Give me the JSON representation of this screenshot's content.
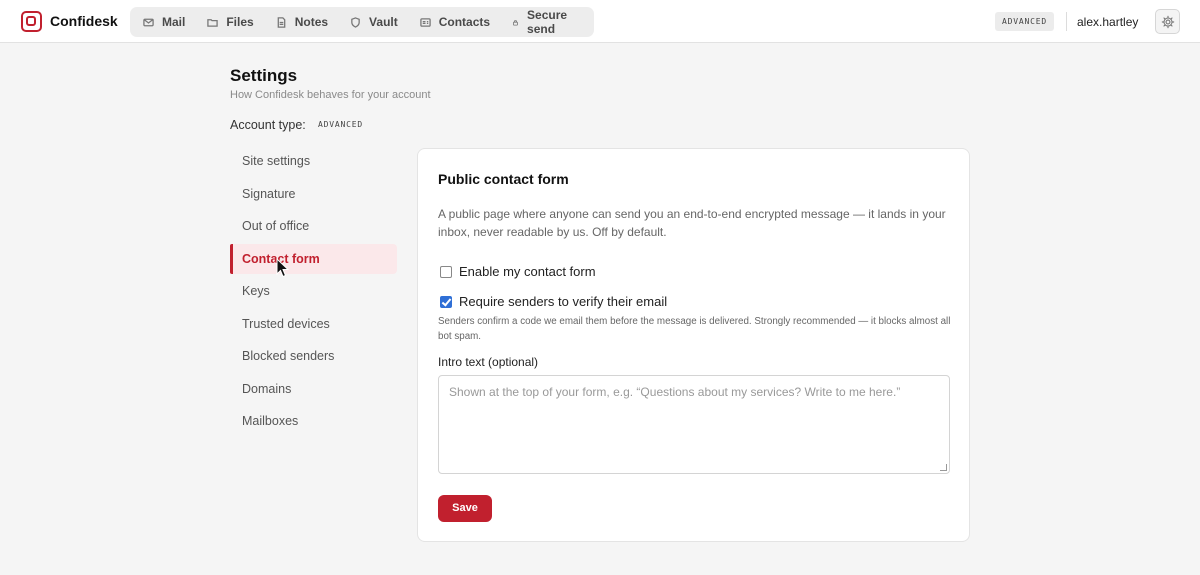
{
  "app": {
    "brand": "Confidesk",
    "accent_color": "#c1202e",
    "account_badge": "ADVANCED",
    "username": "alex.hartley"
  },
  "nav": {
    "items": [
      {
        "label": "Mail",
        "icon": "mail-icon"
      },
      {
        "label": "Files",
        "icon": "folder-icon"
      },
      {
        "label": "Notes",
        "icon": "document-icon"
      },
      {
        "label": "Vault",
        "icon": "shield-icon"
      },
      {
        "label": "Contacts",
        "icon": "contact-card-icon"
      },
      {
        "label": "Secure send",
        "icon": "lock-icon"
      }
    ]
  },
  "header": {
    "title": "Settings",
    "subtitle": "How Confidesk behaves for your account",
    "account_type_label": "Account type:",
    "account_type_value": "ADVANCED"
  },
  "sidebar": {
    "items": [
      {
        "label": "Site settings",
        "active": false
      },
      {
        "label": "Signature",
        "active": false
      },
      {
        "label": "Out of office",
        "active": false
      },
      {
        "label": "Contact form",
        "active": true
      },
      {
        "label": "Keys",
        "active": false
      },
      {
        "label": "Trusted devices",
        "active": false
      },
      {
        "label": "Blocked senders",
        "active": false
      },
      {
        "label": "Domains",
        "active": false
      },
      {
        "label": "Mailboxes",
        "active": false
      }
    ]
  },
  "card": {
    "title": "Public contact form",
    "description": "A public page where anyone can send you an end-to-end encrypted message — it lands in your inbox, never readable by us. Off by default.",
    "enable_label": "Enable my contact form",
    "enable_checked": false,
    "verify_label": "Require senders to verify their email",
    "verify_checked": true,
    "verify_hint": "Senders confirm a code we email them before the message is delivered. Strongly recommended — it blocks almost all bot spam.",
    "intro_label": "Intro text (optional)",
    "intro_placeholder": "Shown at the top of your form, e.g. “Questions about my services? Write to me here.”",
    "intro_value": "",
    "save_label": "Save"
  }
}
